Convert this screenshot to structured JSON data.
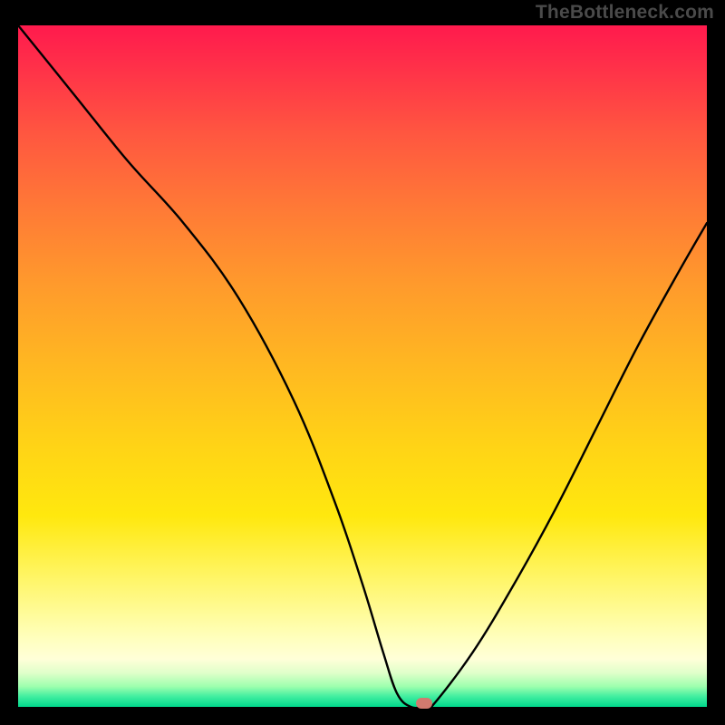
{
  "watermark": "TheBottleneck.com",
  "chart_data": {
    "type": "line",
    "title": "",
    "xlabel": "",
    "ylabel": "",
    "xlim": [
      0,
      100
    ],
    "ylim": [
      0,
      100
    ],
    "x": [
      0,
      8,
      16,
      24,
      32,
      40,
      46,
      50,
      53,
      55,
      57,
      59,
      60,
      66,
      72,
      78,
      84,
      90,
      96,
      100
    ],
    "values": [
      100,
      90,
      80,
      71,
      60,
      45,
      30,
      18,
      8,
      2,
      0,
      0,
      0,
      8,
      18,
      29,
      41,
      53,
      64,
      71
    ],
    "marker": {
      "x": 59,
      "y": 0
    },
    "gradient_stops": [
      {
        "pos": 0,
        "color": "#ff1a4d"
      },
      {
        "pos": 50,
        "color": "#ffb821"
      },
      {
        "pos": 90,
        "color": "#ffffbe"
      },
      {
        "pos": 100,
        "color": "#00d88c"
      }
    ]
  }
}
